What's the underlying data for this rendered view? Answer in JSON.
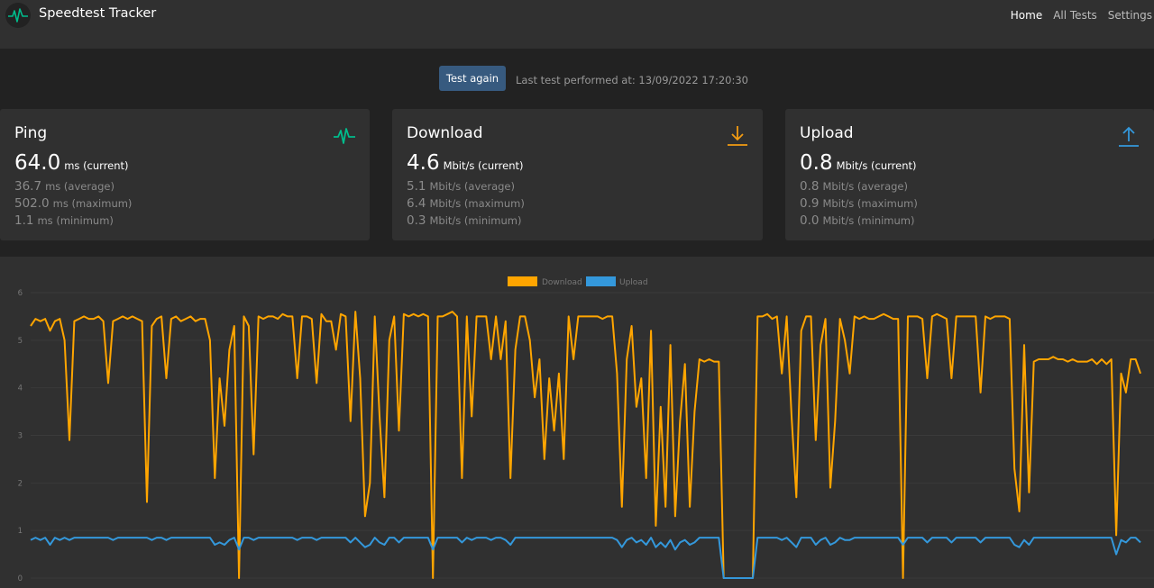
{
  "app": {
    "title": "Speedtest Tracker",
    "logo_icon": "pulse-icon"
  },
  "nav": {
    "items": [
      {
        "label": "Home",
        "active": true
      },
      {
        "label": "All Tests",
        "active": false
      },
      {
        "label": "Settings",
        "active": false
      }
    ]
  },
  "test": {
    "button_label": "Test again",
    "last_test_text": "Last test performed at: 13/09/2022 17:20:30"
  },
  "cards": {
    "ping": {
      "title": "Ping",
      "icon": "pulse-icon",
      "color": "#00bc8c",
      "current": "64.0",
      "current_unit": "ms (current)",
      "average": "36.7",
      "average_unit": "ms (average)",
      "maximum": "502.0",
      "maximum_unit": "ms (maximum)",
      "minimum": "1.1",
      "minimum_unit": "ms (minimum)"
    },
    "download": {
      "title": "Download",
      "icon": "download-arrow-icon",
      "color": "#f39c12",
      "current": "4.6",
      "current_unit": "Mbit/s (current)",
      "average": "5.1",
      "average_unit": "Mbit/s (average)",
      "maximum": "6.4",
      "maximum_unit": "Mbit/s (maximum)",
      "minimum": "0.3",
      "minimum_unit": "Mbit/s (minimum)"
    },
    "upload": {
      "title": "Upload",
      "icon": "upload-arrow-icon",
      "color": "#3498db",
      "current": "0.8",
      "current_unit": "Mbit/s (current)",
      "average": "0.8",
      "average_unit": "Mbit/s (average)",
      "maximum": "0.9",
      "maximum_unit": "Mbit/s (maximum)",
      "minimum": "0.0",
      "minimum_unit": "Mbit/s (minimum)"
    }
  },
  "chart_data": {
    "type": "line",
    "ylim": [
      0,
      6
    ],
    "yticks": [
      "0",
      "1",
      "2",
      "3",
      "4",
      "5",
      "6"
    ],
    "grid": true,
    "legend_position": "top-center",
    "series": [
      {
        "name": "Download",
        "color": "#ffa500",
        "values": [
          5.3,
          5.45,
          5.4,
          5.45,
          5.2,
          5.4,
          5.45,
          5.0,
          2.9,
          5.4,
          5.45,
          5.5,
          5.45,
          5.45,
          5.5,
          5.4,
          4.1,
          5.4,
          5.45,
          5.5,
          5.45,
          5.5,
          5.45,
          5.4,
          1.6,
          5.3,
          5.45,
          5.5,
          4.2,
          5.45,
          5.5,
          5.4,
          5.45,
          5.5,
          5.4,
          5.45,
          5.45,
          5.0,
          2.1,
          4.2,
          3.2,
          4.8,
          5.3,
          0.0,
          5.5,
          5.3,
          2.6,
          5.5,
          5.45,
          5.5,
          5.5,
          5.45,
          5.55,
          5.5,
          5.5,
          4.2,
          5.5,
          5.5,
          5.45,
          4.1,
          5.55,
          5.4,
          5.4,
          4.8,
          5.55,
          5.5,
          3.3,
          5.6,
          4.2,
          1.3,
          2.0,
          5.5,
          3.4,
          1.7,
          5.0,
          5.5,
          3.1,
          5.55,
          5.5,
          5.55,
          5.5,
          5.55,
          5.5,
          0.0,
          5.5,
          5.5,
          5.55,
          5.6,
          5.5,
          2.1,
          5.5,
          3.4,
          5.5,
          5.5,
          5.5,
          4.6,
          5.5,
          4.6,
          5.4,
          2.1,
          4.8,
          5.5,
          5.5,
          5.0,
          3.8,
          4.6,
          2.5,
          4.2,
          3.1,
          4.3,
          2.5,
          5.5,
          4.6,
          5.5,
          5.5,
          5.5,
          5.5,
          5.5,
          5.45,
          5.5,
          5.5,
          4.3,
          1.5,
          4.6,
          5.3,
          3.6,
          4.2,
          2.1,
          5.2,
          1.1,
          3.6,
          1.5,
          4.9,
          1.3,
          3.3,
          4.5,
          1.5,
          3.5,
          4.6,
          4.55,
          4.6,
          4.55,
          4.55,
          0.0,
          0.0,
          0.0,
          0.0,
          0.0,
          0.0,
          0.0,
          5.5,
          5.5,
          5.55,
          5.45,
          5.5,
          4.3,
          5.5,
          3.4,
          1.7,
          5.2,
          5.5,
          5.5,
          2.9,
          4.9,
          5.45,
          1.9,
          3.3,
          5.45,
          5.0,
          4.3,
          5.5,
          5.45,
          5.5,
          5.45,
          5.45,
          5.5,
          5.55,
          5.5,
          5.45,
          5.45,
          0.0,
          5.5,
          5.5,
          5.5,
          5.45,
          4.2,
          5.5,
          5.55,
          5.5,
          5.45,
          4.2,
          5.5,
          5.5,
          5.5,
          5.5,
          5.5,
          3.9,
          5.5,
          5.45,
          5.5,
          5.5,
          5.5,
          5.45,
          2.3,
          1.4,
          4.9,
          1.8,
          4.55,
          4.6,
          4.6,
          4.6,
          4.65,
          4.6,
          4.6,
          4.55,
          4.6,
          4.55,
          4.55,
          4.55,
          4.6,
          4.5,
          4.6,
          4.5,
          4.6,
          0.9,
          4.3,
          3.9,
          4.6,
          4.6,
          4.3
        ]
      },
      {
        "name": "Upload",
        "color": "#3498db",
        "values": [
          0.8,
          0.85,
          0.8,
          0.85,
          0.7,
          0.85,
          0.8,
          0.85,
          0.8,
          0.85,
          0.85,
          0.85,
          0.85,
          0.85,
          0.85,
          0.85,
          0.85,
          0.8,
          0.85,
          0.85,
          0.85,
          0.85,
          0.85,
          0.85,
          0.85,
          0.8,
          0.85,
          0.85,
          0.8,
          0.85,
          0.85,
          0.85,
          0.85,
          0.85,
          0.85,
          0.85,
          0.85,
          0.85,
          0.7,
          0.75,
          0.7,
          0.8,
          0.85,
          0.6,
          0.85,
          0.85,
          0.8,
          0.85,
          0.85,
          0.85,
          0.85,
          0.85,
          0.85,
          0.85,
          0.85,
          0.8,
          0.85,
          0.85,
          0.85,
          0.8,
          0.85,
          0.85,
          0.85,
          0.85,
          0.85,
          0.85,
          0.75,
          0.85,
          0.75,
          0.65,
          0.7,
          0.85,
          0.75,
          0.7,
          0.85,
          0.85,
          0.75,
          0.85,
          0.85,
          0.85,
          0.85,
          0.85,
          0.85,
          0.6,
          0.85,
          0.85,
          0.85,
          0.85,
          0.85,
          0.75,
          0.85,
          0.8,
          0.85,
          0.85,
          0.85,
          0.8,
          0.85,
          0.85,
          0.8,
          0.7,
          0.85,
          0.85,
          0.85,
          0.85,
          0.85,
          0.85,
          0.85,
          0.85,
          0.85,
          0.85,
          0.85,
          0.85,
          0.85,
          0.85,
          0.85,
          0.85,
          0.85,
          0.85,
          0.85,
          0.85,
          0.85,
          0.8,
          0.65,
          0.8,
          0.85,
          0.75,
          0.8,
          0.7,
          0.85,
          0.65,
          0.75,
          0.65,
          0.8,
          0.6,
          0.75,
          0.8,
          0.7,
          0.75,
          0.85,
          0.85,
          0.85,
          0.85,
          0.85,
          0.0,
          0.0,
          0.0,
          0.0,
          0.0,
          0.0,
          0.0,
          0.85,
          0.85,
          0.85,
          0.85,
          0.85,
          0.8,
          0.85,
          0.75,
          0.65,
          0.85,
          0.85,
          0.85,
          0.7,
          0.8,
          0.85,
          0.7,
          0.75,
          0.85,
          0.8,
          0.8,
          0.85,
          0.85,
          0.85,
          0.85,
          0.85,
          0.85,
          0.85,
          0.85,
          0.85,
          0.85,
          0.7,
          0.85,
          0.85,
          0.85,
          0.85,
          0.75,
          0.85,
          0.85,
          0.85,
          0.85,
          0.75,
          0.85,
          0.85,
          0.85,
          0.85,
          0.85,
          0.75,
          0.85,
          0.85,
          0.85,
          0.85,
          0.85,
          0.85,
          0.7,
          0.65,
          0.8,
          0.7,
          0.85,
          0.85,
          0.85,
          0.85,
          0.85,
          0.85,
          0.85,
          0.85,
          0.85,
          0.85,
          0.85,
          0.85,
          0.85,
          0.85,
          0.85,
          0.85,
          0.85,
          0.5,
          0.8,
          0.75,
          0.85,
          0.85,
          0.75
        ]
      }
    ]
  }
}
